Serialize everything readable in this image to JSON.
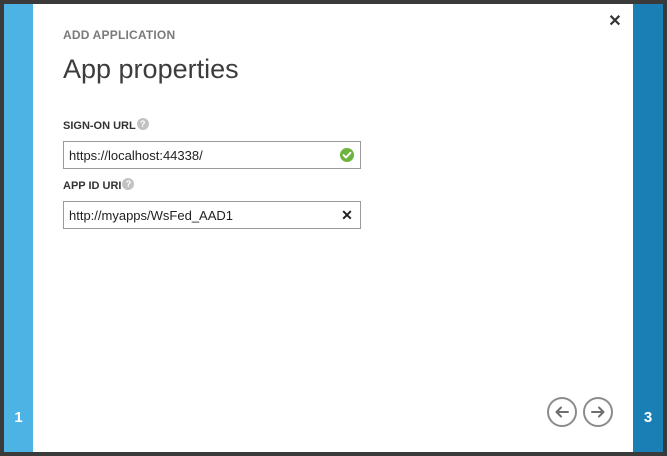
{
  "wizard": {
    "heading": "ADD APPLICATION",
    "title": "App properties",
    "step_left": "1",
    "step_right": "3",
    "close_glyph": "✕"
  },
  "fields": {
    "sign_on_url": {
      "label": "SIGN-ON URL",
      "value": "https://localhost:44338/",
      "status_icon": "check-circle-icon",
      "status_color": "#6db33f"
    },
    "app_id_uri": {
      "label": "APP ID URI",
      "value": "http://myapps/WsFed_AAD1",
      "action_icon": "clear-icon"
    }
  },
  "help_glyph": "?",
  "nav": {
    "back_icon": "arrow-left-icon",
    "next_icon": "arrow-right-icon"
  },
  "colors": {
    "left_rail": "#4db2e4",
    "right_rail": "#1a7fb5"
  }
}
